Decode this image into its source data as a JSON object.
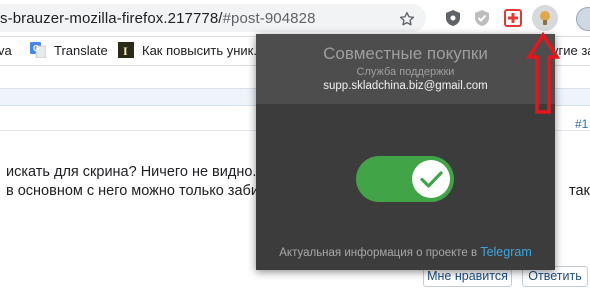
{
  "browser": {
    "url_main": "s-brauzer-mozilla-firefox.217778/",
    "url_rest": "#post-904828",
    "bookmark_star_icon": "star-outline-icon",
    "extensions": [
      "shield-icon",
      "check-shield-icon",
      "red-cross-icon",
      "lightbulb-icon"
    ]
  },
  "bookmarks": {
    "items": [
      {
        "label": "va",
        "icon": "folder-icon"
      },
      {
        "label": "Translate",
        "icon": "google-translate-icon"
      },
      {
        "label": "Как повысить уник...",
        "icon": "book-icon"
      },
      {
        "label": "угие за"
      }
    ]
  },
  "page": {
    "post_number": "#1",
    "line1_left": "искать для скрина? Ничего не видно. Захо",
    "line2_left": "в основном с него можно только забирать",
    "line2_right": "так",
    "like_button": "Мне нравится",
    "reply_button": "Ответить"
  },
  "popup": {
    "title": "Совместные покупки",
    "subtitle": "Служба поддержки",
    "email": "supp.skladchina.biz@gmail.com",
    "toggle_on": true,
    "footer_text": "Актуальная информация о проекте в",
    "footer_link": "Telegram",
    "accent_green": "#41a447",
    "link_color": "#3ea7e0"
  }
}
